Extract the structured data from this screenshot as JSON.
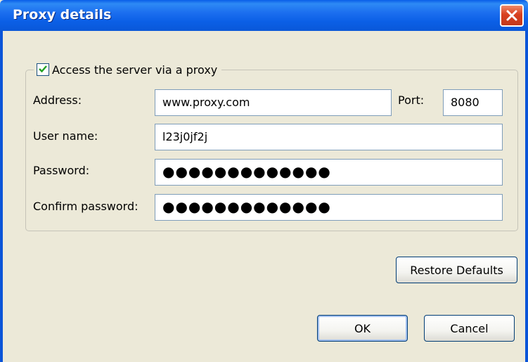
{
  "window": {
    "title": "Proxy details"
  },
  "proxy": {
    "checkbox_label": "Access the server via a proxy",
    "checked": true,
    "address_label": "Address:",
    "address_value": "www.proxy.com",
    "port_label": "Port:",
    "port_value": "8080",
    "username_label": "User name:",
    "username_value": "l23j0jf2j",
    "password_label": "Password:",
    "password_value": "●●●●●●●●●●●●●",
    "confirm_label": "Confirm password:",
    "confirm_value": "●●●●●●●●●●●●●"
  },
  "buttons": {
    "restore": "Restore Defaults",
    "ok": "OK",
    "cancel": "Cancel"
  },
  "icons": {
    "close": "close-icon",
    "check": "checkmark-icon"
  },
  "colors": {
    "titlebar": "#0b5fe6",
    "close": "#d8401e",
    "dialog_bg": "#ece9d8"
  }
}
